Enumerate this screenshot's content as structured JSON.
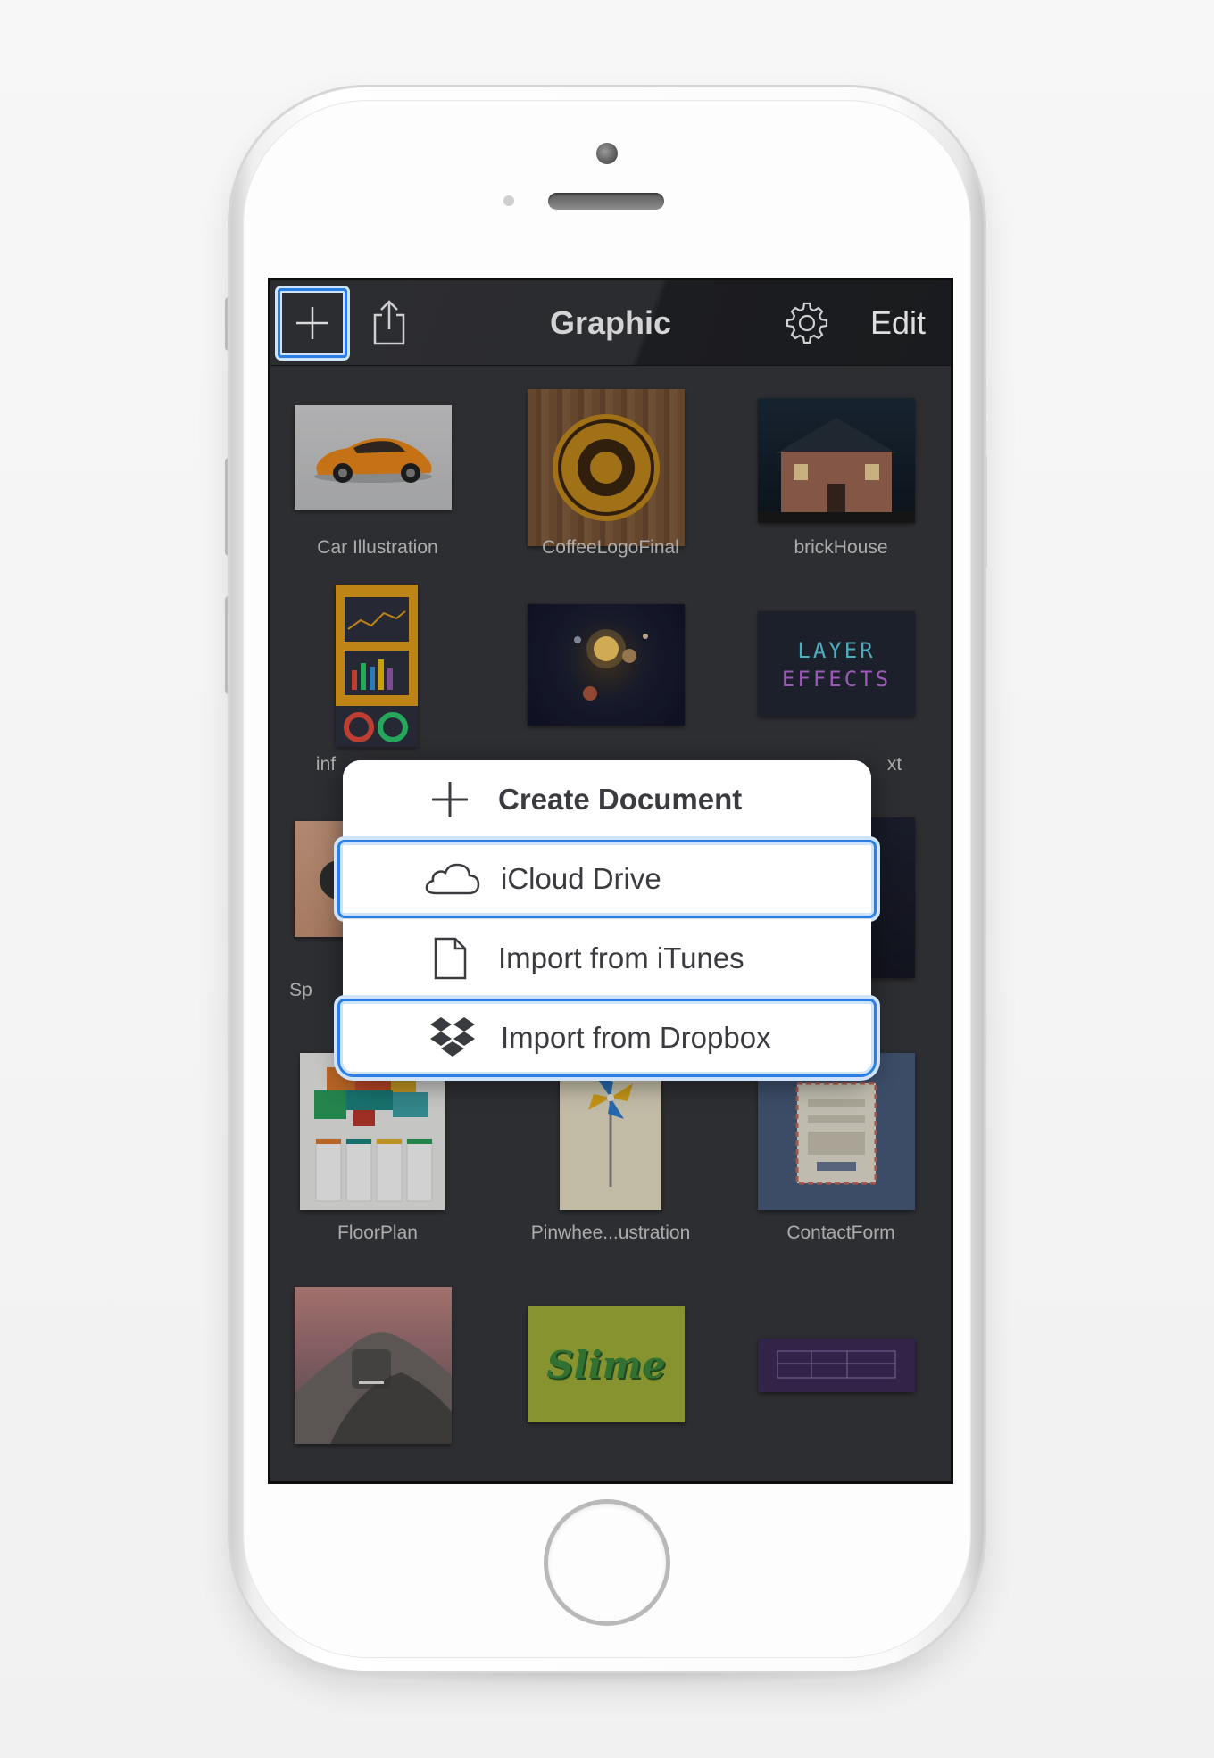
{
  "navbar": {
    "title": "Graphic",
    "edit_label": "Edit",
    "add_icon": "plus-icon",
    "share_icon": "share-icon",
    "settings_icon": "gear-icon"
  },
  "documents": [
    {
      "name": "Car Illustration"
    },
    {
      "name": "CoffeeLogoFinal"
    },
    {
      "name": "brickHouse"
    },
    {
      "name": "inf"
    },
    {
      "name": ""
    },
    {
      "name": "xt"
    },
    {
      "name": "Sp"
    },
    {
      "name": ""
    },
    {
      "name": ""
    },
    {
      "name": "FloorPlan"
    },
    {
      "name": "Pinwhee...ustration"
    },
    {
      "name": "ContactForm"
    },
    {
      "name": ""
    },
    {
      "name": ""
    },
    {
      "name": ""
    }
  ],
  "thumb_text": {
    "layer_effects_line1": "LAYER",
    "layer_effects_line2": "EFFECTS",
    "slime": "Slime"
  },
  "menu": {
    "create": "Create Document",
    "icloud": "iCloud Drive",
    "itunes": "Import from iTunes",
    "dropbox": "Import from Dropbox"
  },
  "colors": {
    "accent": "#2a7fe6",
    "navbar_bg": "#2b2c2f",
    "content_bg": "#38393d",
    "menu_text": "#3a3b3f"
  }
}
